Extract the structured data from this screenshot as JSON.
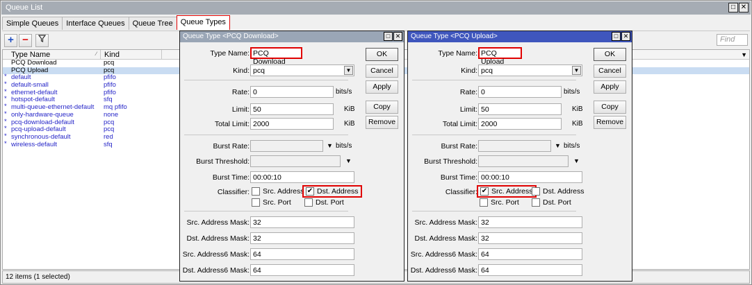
{
  "window": {
    "title": "Queue List"
  },
  "tabs": [
    "Simple Queues",
    "Interface Queues",
    "Queue Tree",
    "Queue Types"
  ],
  "toolbar": {
    "find_placeholder": "Find"
  },
  "table": {
    "headers": [
      "Type Name",
      "Kind"
    ],
    "rows": [
      {
        "name": "PCQ Download",
        "kind": "pcq"
      },
      {
        "name": "PCQ Upload",
        "kind": "pcq"
      },
      {
        "name": "default",
        "kind": "pfifo"
      },
      {
        "name": "default-small",
        "kind": "pfifo"
      },
      {
        "name": "ethernet-default",
        "kind": "pfifo"
      },
      {
        "name": "hotspot-default",
        "kind": "sfq"
      },
      {
        "name": "multi-queue-ethernet-default",
        "kind": "mq pfifo"
      },
      {
        "name": "only-hardware-queue",
        "kind": "none"
      },
      {
        "name": "pcq-download-default",
        "kind": "pcq"
      },
      {
        "name": "pcq-upload-default",
        "kind": "pcq"
      },
      {
        "name": "synchronous-default",
        "kind": "red"
      },
      {
        "name": "wireless-default",
        "kind": "sfq"
      }
    ],
    "status": "12 items (1 selected)"
  },
  "dialogs": [
    {
      "title": "Queue Type <PCQ Download>",
      "type_name": "PCQ Download",
      "kind": "pcq",
      "rate": "0",
      "limit": "50",
      "total_limit": "2000",
      "burst_rate": "",
      "burst_threshold": "",
      "burst_time": "00:00:10",
      "src_mask": "32",
      "dst_mask": "32",
      "src6_mask": "64",
      "dst6_mask": "64",
      "classifier": {
        "src_address": false,
        "dst_address": true,
        "src_port": false,
        "dst_port": false
      }
    },
    {
      "title": "Queue Type <PCQ Upload>",
      "type_name": "PCQ Upload",
      "kind": "pcq",
      "rate": "0",
      "limit": "50",
      "total_limit": "2000",
      "burst_rate": "",
      "burst_threshold": "",
      "burst_time": "00:00:10",
      "src_mask": "32",
      "dst_mask": "32",
      "src6_mask": "64",
      "dst6_mask": "64",
      "classifier": {
        "src_address": true,
        "dst_address": false,
        "src_port": false,
        "dst_port": false
      }
    }
  ],
  "labels": {
    "type_name": "Type Name:",
    "kind": "Kind:",
    "rate": "Rate:",
    "limit": "Limit:",
    "total_limit": "Total Limit:",
    "burst_rate": "Burst Rate:",
    "burst_threshold": "Burst Threshold:",
    "burst_time": "Burst Time:",
    "classifier": "Classifier:",
    "src_address": "Src. Address",
    "dst_address": "Dst. Address",
    "src_port": "Src. Port",
    "dst_port": "Dst. Port",
    "src_mask": "Src. Address Mask:",
    "dst_mask": "Dst. Address Mask:",
    "src6_mask": "Src. Address6 Mask:",
    "dst6_mask": "Dst. Address6 Mask:",
    "bits": "bits/s",
    "kib": "KiB"
  },
  "buttons": {
    "ok": "OK",
    "cancel": "Cancel",
    "apply": "Apply",
    "copy": "Copy",
    "remove": "Remove"
  },
  "colors": {
    "highlight": "#e00000",
    "dynamic_text": "#2626c8",
    "selected_row": "#c9dcf2",
    "active_title": "#3f56bd"
  }
}
